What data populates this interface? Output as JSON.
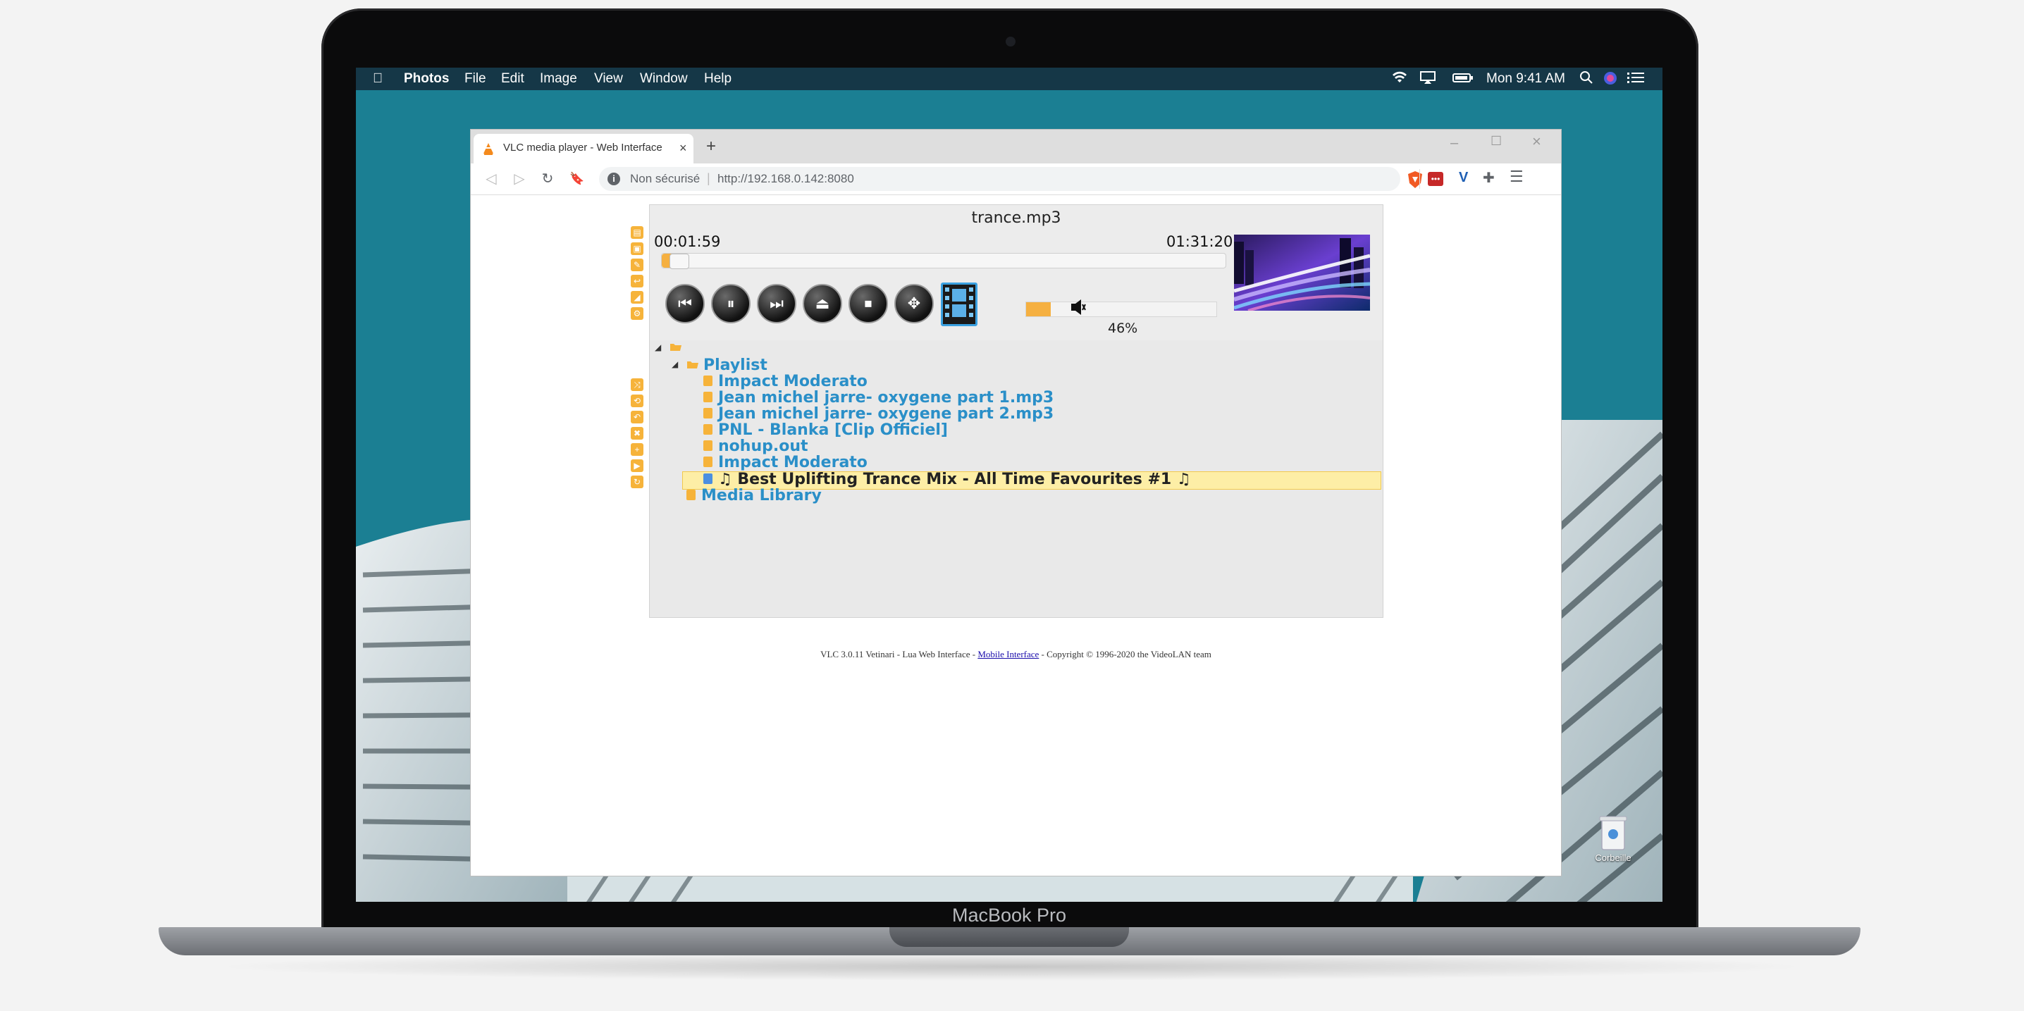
{
  "device": {
    "brand_label": "MacBook Pro"
  },
  "menubar": {
    "app_name": "Photos",
    "items": [
      "File",
      "Edit",
      "Image",
      "View",
      "Window",
      "Help"
    ],
    "clock": "Mon 9:41 AM"
  },
  "desktop": {
    "trash_label": "Corbeille"
  },
  "browser": {
    "tab_title": "VLC media player - Web Interface",
    "security_label": "Non sécurisé",
    "url": "http://192.168.0.142:8080"
  },
  "vlc": {
    "now_playing": "trance.mp3",
    "elapsed": "00:01:59",
    "duration": "01:31:20",
    "seek_fraction": 0.0217,
    "volume_percent_label": "46%",
    "volume_fraction": 0.46,
    "playlist": {
      "root_label": "Playlist",
      "items": [
        {
          "label": "Impact Moderato",
          "current": false
        },
        {
          "label": "Jean michel jarre- oxygene part 1.mp3",
          "current": false
        },
        {
          "label": "Jean michel jarre- oxygene part 2.mp3",
          "current": false
        },
        {
          "label": "PNL - Blanka [Clip Officiel]",
          "current": false
        },
        {
          "label": "nohup.out",
          "current": false
        },
        {
          "label": "Impact Moderato",
          "current": false
        },
        {
          "label": "♫ Best Uplifting Trance Mix - All Time Favourites #1 ♫",
          "current": true
        }
      ],
      "library_label": "Media Library"
    },
    "footer": {
      "prefix": "VLC 3.0.11 Vetinari - Lua Web Interface - ",
      "link": "Mobile Interface",
      "suffix": " - Copyright © 1996-2020 the VideoLAN team"
    }
  },
  "colors": {
    "accent": "#f5b041",
    "link": "#2a8fc8",
    "highlight": "#fdeea6"
  }
}
